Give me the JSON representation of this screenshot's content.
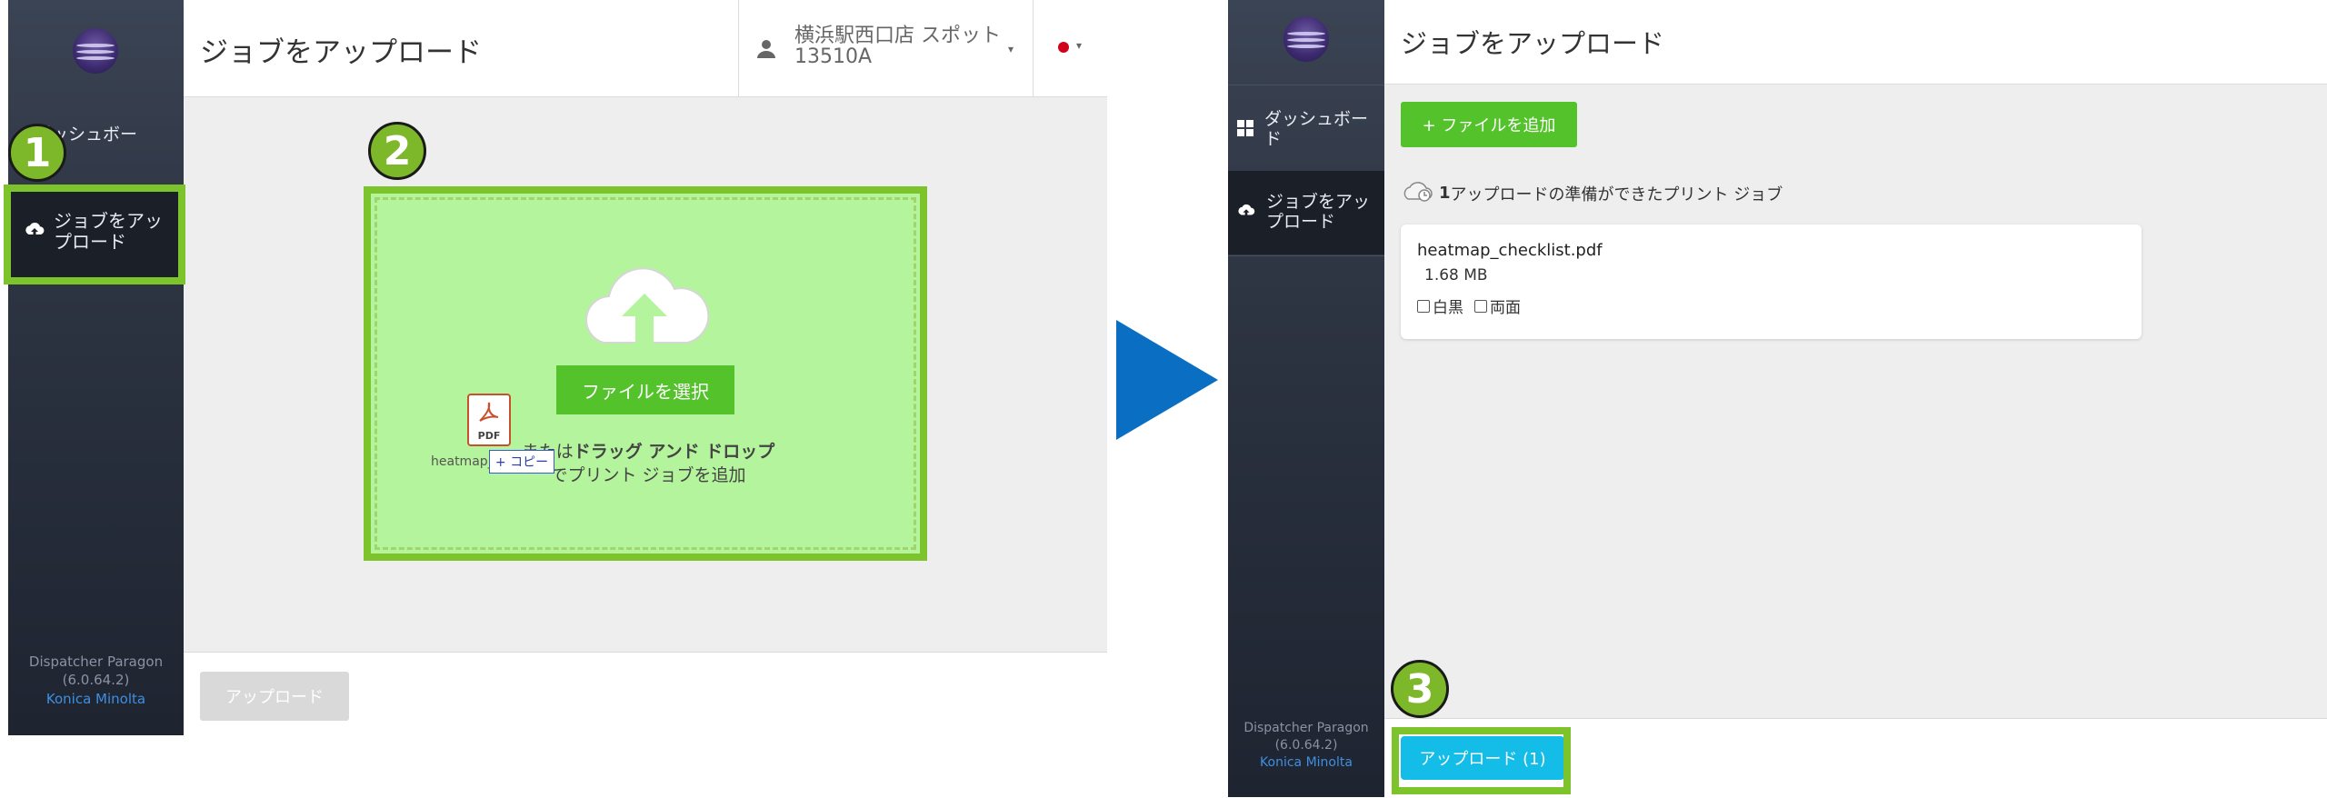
{
  "sidebar": {
    "dashboard_label": "ダッシュボー\nド",
    "upload_label": "ジョブをアッ\nプロード",
    "product_name": "Dispatcher Paragon",
    "version": "(6.0.64.2)",
    "vendor_link": "Konica Minolta"
  },
  "left_panel": {
    "header_title": "ジョブをアップロード",
    "user_name": "横浜駅西口店 スポット",
    "user_id": "13510A",
    "select_file_button": "ファイルを選択",
    "drag_text_prefix": "または",
    "drag_text_bold": "ドラッグ アンド ドロップ",
    "drag_text_suffix": "でプリント ジョブを追加",
    "drag_file_name": "heatmap_",
    "drag_file_type": "PDF",
    "drag_copy_label": "+ コピー",
    "upload_button": "アップロード"
  },
  "right_panel": {
    "header_title": "ジョブをアップロード",
    "add_file_button": "+ ファイルを追加",
    "ready_count": "1",
    "ready_text": "アップロードの準備ができたプリント ジョブ",
    "file": {
      "name": "heatmap_checklist.pdf",
      "size": "1.68 MB",
      "option_mono": "白黒",
      "option_duplex": "両面"
    },
    "upload_button": "アップロード (1)"
  },
  "callouts": {
    "step1": "1",
    "step2": "2",
    "step3": "3"
  },
  "colors": {
    "sidebar_bg": "#2c3341",
    "accent_green": "#53c22b",
    "highlight_green": "#7dc42c",
    "dropzone_bg": "#b4f49c",
    "arrow_blue": "#0a6fc2",
    "upload_cyan": "#13bde8",
    "status_red": "#d0021b"
  }
}
